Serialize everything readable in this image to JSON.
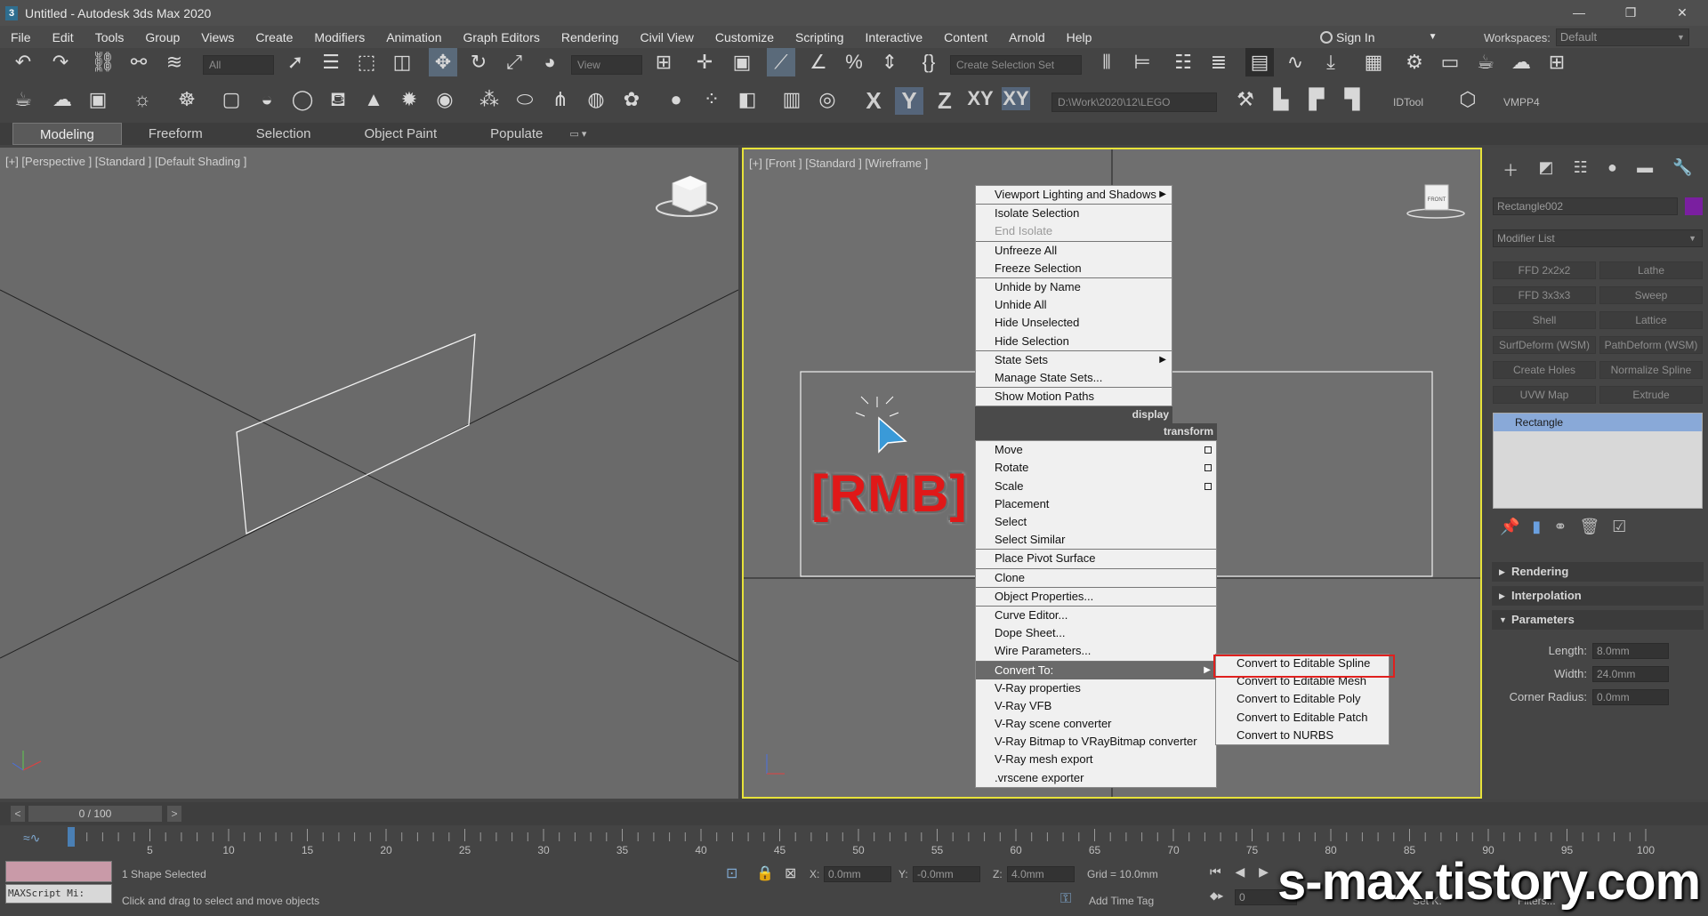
{
  "window": {
    "title": "Untitled - Autodesk 3ds Max 2020",
    "logo": "3",
    "minimize": "—",
    "restore": "❐",
    "close": "✕"
  },
  "menu": [
    "File",
    "Edit",
    "Tools",
    "Group",
    "Views",
    "Create",
    "Modifiers",
    "Animation",
    "Graph Editors",
    "Rendering",
    "Civil View",
    "Customize",
    "Scripting",
    "Interactive",
    "Content",
    "Arnold",
    "Help"
  ],
  "signin": {
    "label": "Sign In"
  },
  "workspaces": {
    "label": "Workspaces:",
    "value": "Default"
  },
  "toolbar": {
    "filter": "All",
    "refcoord": "View",
    "selset": "Create Selection Set",
    "path": "D:\\Work\\2020\\12\\LEGO",
    "idtool": "IDTool",
    "vmpp": "VMPP4",
    "axis_x": "X",
    "axis_y": "Y",
    "axis_z": "Z",
    "axis_xy": "XY",
    "axis_xy2": "XY"
  },
  "ribbon": {
    "tabs": [
      "Modeling",
      "Freeform",
      "Selection",
      "Object Paint",
      "Populate"
    ],
    "active": "Modeling"
  },
  "viewports": {
    "perspective": "[+] [Perspective ] [Standard ] [Default Shading ]",
    "front": "[+] [Front ] [Standard ] [Wireframe ]",
    "front_cube": "FRONT"
  },
  "context_menu": {
    "display": [
      {
        "label": "Viewport Lighting and Shadows",
        "arrow": true
      },
      {
        "sep": true
      },
      {
        "label": "Isolate Selection"
      },
      {
        "label": "End Isolate",
        "disabled": true
      },
      {
        "sep": true
      },
      {
        "label": "Unfreeze All"
      },
      {
        "label": "Freeze Selection"
      },
      {
        "sep": true
      },
      {
        "label": "Unhide by Name"
      },
      {
        "label": "Unhide All"
      },
      {
        "label": "Hide Unselected"
      },
      {
        "label": "Hide Selection"
      },
      {
        "sep": true
      },
      {
        "label": "State Sets",
        "arrow": true
      },
      {
        "label": "Manage State Sets..."
      },
      {
        "sep": true
      },
      {
        "label": "Show Motion Paths"
      }
    ],
    "display_header": "display",
    "transform_header": "transform",
    "transform": [
      {
        "label": "Move",
        "box": true
      },
      {
        "label": "Rotate",
        "box": true
      },
      {
        "label": "Scale",
        "box": true
      },
      {
        "label": "Placement"
      },
      {
        "label": "Select"
      },
      {
        "label": "Select Similar"
      },
      {
        "sep": true
      },
      {
        "label": "Place Pivot Surface"
      },
      {
        "sep": true
      },
      {
        "label": "Clone"
      },
      {
        "sep": true
      },
      {
        "label": "Object Properties..."
      },
      {
        "sep": true
      },
      {
        "label": "Curve Editor..."
      },
      {
        "label": "Dope Sheet..."
      },
      {
        "label": "Wire Parameters..."
      },
      {
        "sep": true
      },
      {
        "label": "Convert To:",
        "arrow": true,
        "highlight": true
      },
      {
        "label": "V-Ray properties"
      },
      {
        "label": "V-Ray VFB"
      },
      {
        "label": "V-Ray scene converter"
      },
      {
        "label": "V-Ray Bitmap to VRayBitmap converter"
      },
      {
        "label": "V-Ray mesh export"
      },
      {
        "label": ".vrscene exporter"
      }
    ],
    "submenu": [
      "Convert to Editable Spline",
      "Convert to Editable Mesh",
      "Convert to Editable Poly",
      "Convert to Editable Patch",
      "Convert to NURBS"
    ]
  },
  "annotation": {
    "rmb": "[RMB]"
  },
  "command_panel": {
    "object_name": "Rectangle002",
    "object_color": "#7a1fa0",
    "modifier_list": "Modifier List",
    "modifier_buttons": [
      "FFD 2x2x2",
      "Lathe",
      "FFD 3x3x3",
      "Sweep",
      "Shell",
      "Lattice",
      "SurfDeform (WSM)",
      "PathDeform (WSM)",
      "Create Holes",
      "Normalize Spline",
      "UVW Map",
      "Extrude"
    ],
    "stack": [
      "Rectangle"
    ],
    "rollouts": [
      "Rendering",
      "Interpolation",
      "Parameters"
    ],
    "params": [
      {
        "label": "Length:",
        "value": "8.0mm"
      },
      {
        "label": "Width:",
        "value": "24.0mm"
      },
      {
        "label": "Corner Radius:",
        "value": "0.0mm"
      }
    ]
  },
  "timeline": {
    "frame": "0 / 100",
    "prev": "<",
    "next": ">",
    "ticks": [
      "5",
      "10",
      "15",
      "20",
      "25",
      "30",
      "35",
      "40",
      "45",
      "50",
      "55",
      "60",
      "65",
      "70",
      "75",
      "80",
      "85",
      "90",
      "95",
      "100"
    ]
  },
  "status": {
    "selected": "1 Shape Selected",
    "prompt": "Click and drag to select and move objects",
    "maxscript": "MAXScript Mi:",
    "x": "0.0mm",
    "y": "-0.0mm",
    "z": "4.0mm",
    "grid": "Grid = 10.0mm",
    "add_time_tag": "Add Time Tag",
    "frame_field": "0",
    "setk": "Set K.",
    "filters": "Filters..."
  },
  "watermark": "s-max.tistory.com"
}
